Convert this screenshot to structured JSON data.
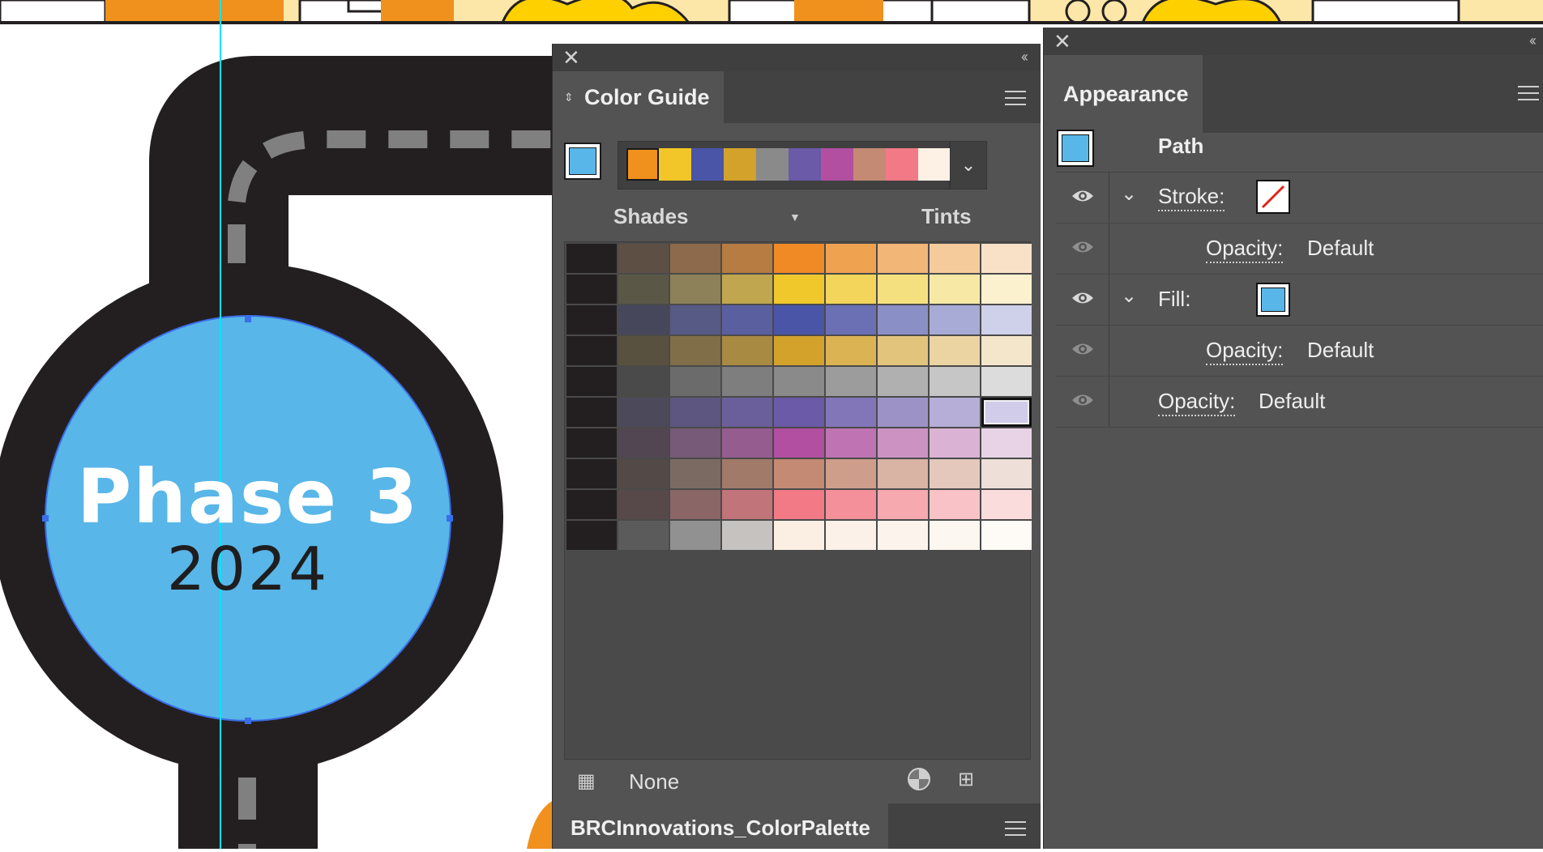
{
  "artwork": {
    "phase_title": "Phase 3",
    "phase_year": "2024",
    "colors": {
      "road": "#231f20",
      "road_dash": "#808080",
      "circle_fill": "#58b6e8",
      "guide_line": "#00e5ff",
      "selection": "#3a6ee8",
      "banner_orange": "#f0901d",
      "banner_yellow": "#ffd000",
      "banner_cream": "#fde7a8"
    }
  },
  "color_guide": {
    "close_icon": "close-icon",
    "collapse_icon": "collapse-double-chevron-icon",
    "tab_label": "Color Guide",
    "menu_icon": "hamburger-icon",
    "base_color": "#58b6e8",
    "harmony_colors": [
      "#f0901d",
      "#f2c628",
      "#4a55a8",
      "#d3a22b",
      "#8a8a8a",
      "#6a5aa8",
      "#b24fa0",
      "#c48a74",
      "#f17a86",
      "#fdf1e6"
    ],
    "shades_label": "Shades",
    "tints_label": "Tints",
    "grid_rows": [
      [
        "#231f20",
        "#5e4f45",
        "#8c6a4b",
        "#b67c42",
        "#ef8a24",
        "#efa24f",
        "#f2b677",
        "#f6cb9c",
        "#f9e1c8"
      ],
      [
        "#231f20",
        "#5b5747",
        "#8c8158",
        "#c0a64e",
        "#f0c82b",
        "#f2d55a",
        "#f5e080",
        "#f8e8a5",
        "#fbf1cf"
      ],
      [
        "#231f20",
        "#46475b",
        "#575a85",
        "#5a5fa0",
        "#4a55a8",
        "#6b70b5",
        "#8a8fc6",
        "#a8abd5",
        "#cfd1ea"
      ],
      [
        "#231f20",
        "#58513f",
        "#7f6e47",
        "#a88a43",
        "#d3a22b",
        "#dcb353",
        "#e3c47c",
        "#ebd4a2",
        "#f3e6cb"
      ],
      [
        "#231f20",
        "#4b4a4b",
        "#6b6b6b",
        "#7e7e7e",
        "#8a8a8a",
        "#9c9c9c",
        "#b0b0b0",
        "#c6c6c6",
        "#dcdcdc"
      ],
      [
        "#231f20",
        "#4c4a5a",
        "#5d5680",
        "#6a5f9a",
        "#6a5aa8",
        "#8376b8",
        "#9c92c6",
        "#b6aed6",
        "#d1ccea"
      ],
      [
        "#231f20",
        "#514651",
        "#765a77",
        "#955d8f",
        "#b24fa0",
        "#bf73b2",
        "#cc93c2",
        "#dab3d4",
        "#e8d3e6"
      ],
      [
        "#231f20",
        "#534947",
        "#7b6a62",
        "#a17a6a",
        "#c48a74",
        "#cf9e8b",
        "#d9b3a3",
        "#e4c8bc",
        "#eedfd8"
      ],
      [
        "#231f20",
        "#574849",
        "#8a6667",
        "#c17479",
        "#f17a86",
        "#f39099",
        "#f6a9af",
        "#f9c2c6",
        "#fbdcdd"
      ],
      [
        "#231f20",
        "#5c5b5b",
        "#929191",
        "#c6c2c0",
        "#fbefe4",
        "#fbf1e8",
        "#fcf4ec",
        "#fdf7f1",
        "#fefaf6"
      ]
    ],
    "selected_swatch": "#d1ccea",
    "footer_icon_grid": "swatch-grid-icon",
    "footer_group_label": "None",
    "footer_icon_wheel": "color-wheel-icon",
    "footer_icon_save": "save-to-swatches-icon",
    "bottom_tab_label": "BRCInnovations_ColorPalette"
  },
  "appearance": {
    "close_icon": "close-icon",
    "collapse_icon": "collapse-double-chevron-icon",
    "tab_label": "Appearance",
    "menu_icon": "hamburger-icon",
    "object_label": "Path",
    "object_color": "#58b6e8",
    "stroke_label": "Stroke:",
    "stroke_opacity_label": "Opacity:",
    "stroke_opacity_value": "Default",
    "fill_label": "Fill:",
    "fill_color": "#58b6e8",
    "fill_opacity_label": "Opacity:",
    "fill_opacity_value": "Default",
    "object_opacity_label": "Opacity:",
    "object_opacity_value": "Default"
  }
}
